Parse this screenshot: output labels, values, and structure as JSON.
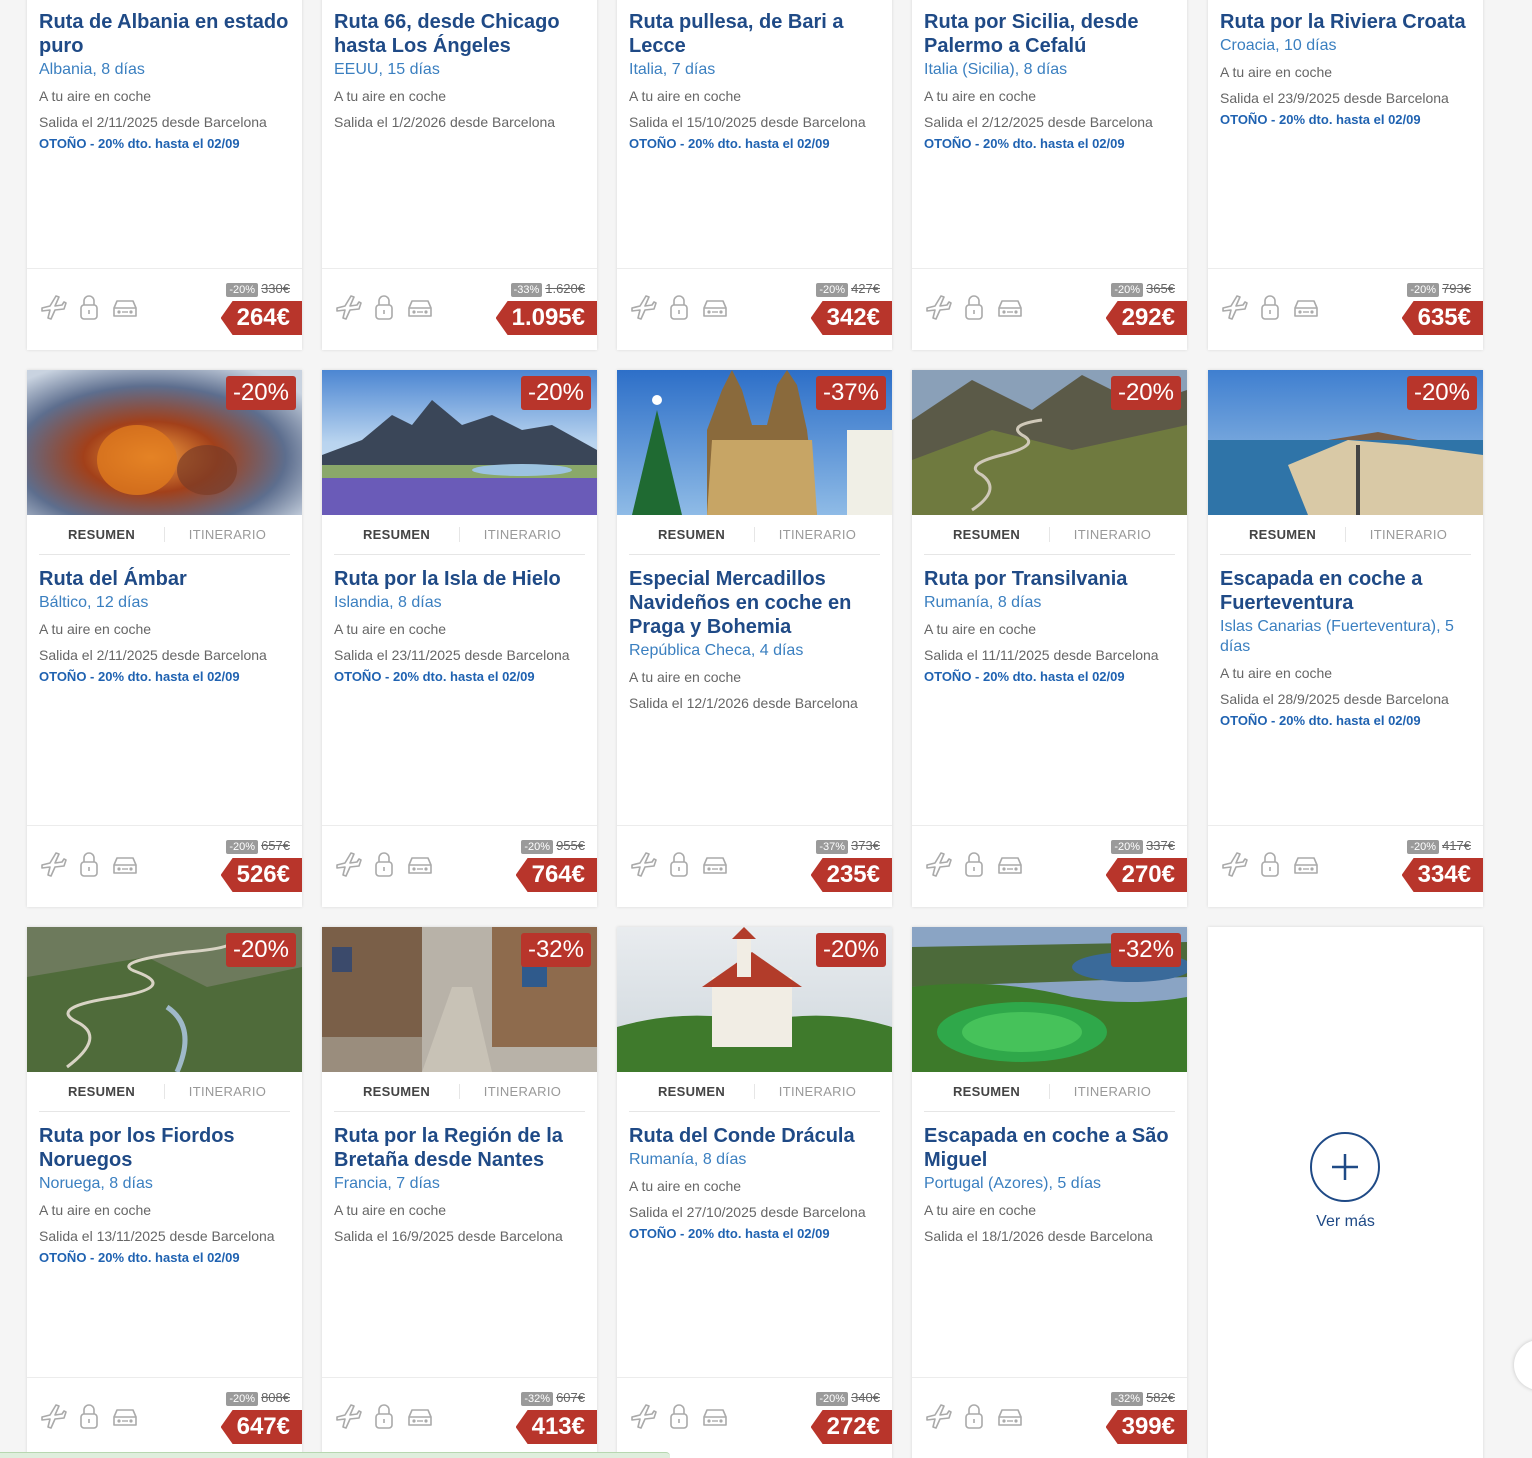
{
  "labels": {
    "resumen": "RESUMEN",
    "itinerario": "ITINERARIO",
    "ver_mas": "Ver más"
  },
  "icons": [
    "plane-icon",
    "lock-icon",
    "car-icon"
  ],
  "colors": {
    "brand_blue": "#1f4a86",
    "price_red": "#b8352b",
    "promo_blue": "#1f62b1"
  },
  "cards": [
    {
      "title": "Ruta de Albania en estado puro",
      "dest": "Albania, 8 días",
      "mode": "A tu aire en coche",
      "dep": "Salida el 2/11/2025 desde Barcelona",
      "promo": "OTOÑO - 20% dto. hasta el 02/09",
      "badge": "",
      "pct": "-20%",
      "old": "330€",
      "price": "264€"
    },
    {
      "title": "Ruta 66, desde Chicago hasta Los Ángeles",
      "dest": "EEUU, 15 días",
      "mode": "A tu aire en coche",
      "dep": "Salida el 1/2/2026 desde Barcelona",
      "promo": "",
      "badge": "",
      "pct": "-33%",
      "old": "1.620€",
      "price": "1.095€"
    },
    {
      "title": "Ruta pullesa, de Bari a Lecce",
      "dest": "Italia, 7 días",
      "mode": "A tu aire en coche",
      "dep": "Salida el 15/10/2025 desde Barcelona",
      "promo": "OTOÑO - 20% dto. hasta el 02/09",
      "badge": "",
      "pct": "-20%",
      "old": "427€",
      "price": "342€"
    },
    {
      "title": "Ruta por Sicilia, desde Palermo a Cefalú",
      "dest": "Italia (Sicilia), 8 días",
      "mode": "A tu aire en coche",
      "dep": "Salida el 2/12/2025 desde Barcelona",
      "promo": "OTOÑO - 20% dto. hasta el 02/09",
      "badge": "",
      "pct": "-20%",
      "old": "365€",
      "price": "292€"
    },
    {
      "title": "Ruta por la Riviera Croata",
      "dest": "Croacia, 10 días",
      "mode": "A tu aire en coche",
      "dep": "Salida el 23/9/2025 desde Barcelona",
      "promo": "OTOÑO - 20% dto. hasta el 02/09",
      "badge": "",
      "pct": "-20%",
      "old": "793€",
      "price": "635€"
    },
    {
      "title": "Ruta del Ámbar",
      "dest": "Báltico, 12 días",
      "mode": "A tu aire en coche",
      "dep": "Salida el 2/11/2025 desde Barcelona",
      "promo": "OTOÑO - 20% dto. hasta el 02/09",
      "badge": "-20%",
      "pct": "-20%",
      "old": "657€",
      "price": "526€"
    },
    {
      "title": "Ruta por la Isla de Hielo",
      "dest": "Islandia, 8 días",
      "mode": "A tu aire en coche",
      "dep": "Salida el 23/11/2025 desde Barcelona",
      "promo": "OTOÑO - 20% dto. hasta el 02/09",
      "badge": "-20%",
      "pct": "-20%",
      "old": "955€",
      "price": "764€"
    },
    {
      "title": "Especial Mercadillos Navideños en coche en Praga y Bohemia",
      "dest": "República Checa, 4 días",
      "mode": "A tu aire en coche",
      "dep": "Salida el 12/1/2026 desde Barcelona",
      "promo": "",
      "badge": "-37%",
      "pct": "-37%",
      "old": "373€",
      "price": "235€"
    },
    {
      "title": "Ruta por Transilvania",
      "dest": "Rumanía, 8 días",
      "mode": "A tu aire en coche",
      "dep": "Salida el 11/11/2025 desde Barcelona",
      "promo": "OTOÑO - 20% dto. hasta el 02/09",
      "badge": "-20%",
      "pct": "-20%",
      "old": "337€",
      "price": "270€"
    },
    {
      "title": "Escapada en coche a Fuerteventura",
      "dest": "Islas Canarias (Fuerteventura), 5 días",
      "mode": "A tu aire en coche",
      "dep": "Salida el 28/9/2025 desde Barcelona",
      "promo": "OTOÑO - 20% dto. hasta el 02/09",
      "badge": "-20%",
      "pct": "-20%",
      "old": "417€",
      "price": "334€"
    },
    {
      "title": "Ruta por los Fiordos Noruegos",
      "dest": "Noruega, 8 días",
      "mode": "A tu aire en coche",
      "dep": "Salida el 13/11/2025 desde Barcelona",
      "promo": "OTOÑO - 20% dto. hasta el 02/09",
      "badge": "-20%",
      "pct": "-20%",
      "old": "808€",
      "price": "647€"
    },
    {
      "title": "Ruta por la Región de la Bretaña desde Nantes",
      "dest": "Francia, 7 días",
      "mode": "A tu aire en coche",
      "dep": "Salida el 16/9/2025 desde Barcelona",
      "promo": "",
      "badge": "-32%",
      "pct": "-32%",
      "old": "607€",
      "price": "413€"
    },
    {
      "title": "Ruta del Conde Drácula",
      "dest": "Rumanía, 8 días",
      "mode": "A tu aire en coche",
      "dep": "Salida el 27/10/2025 desde Barcelona",
      "promo": "OTOÑO - 20% dto. hasta el 02/09",
      "badge": "-20%",
      "pct": "-20%",
      "old": "340€",
      "price": "272€"
    },
    {
      "title": "Escapada en coche a São Miguel",
      "dest": "Portugal (Azores), 5 días",
      "mode": "A tu aire en coche",
      "dep": "Salida el 18/1/2026 desde Barcelona",
      "promo": "",
      "badge": "-32%",
      "pct": "-32%",
      "old": "582€",
      "price": "399€"
    }
  ]
}
